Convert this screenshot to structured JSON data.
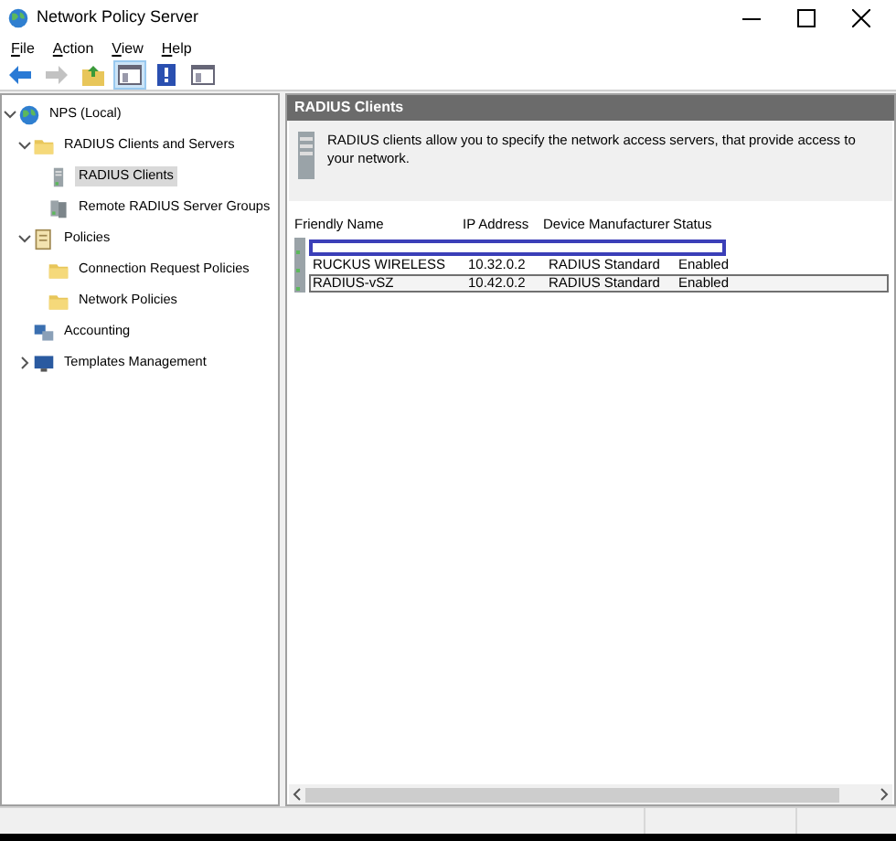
{
  "window": {
    "title": "Network Policy Server"
  },
  "menu": [
    "File",
    "Action",
    "View",
    "Help"
  ],
  "toolbar": [
    {
      "kind": "back",
      "disabled": false,
      "selected": false
    },
    {
      "kind": "forward",
      "disabled": true,
      "selected": false
    },
    {
      "kind": "up",
      "disabled": false,
      "selected": false
    },
    {
      "kind": "pane",
      "disabled": false,
      "selected": true
    },
    {
      "kind": "help",
      "disabled": false,
      "selected": false
    },
    {
      "kind": "pane",
      "disabled": false,
      "selected": false
    }
  ],
  "tree": [
    {
      "label": "NPS (Local)",
      "selected": false,
      "expanded": true,
      "children": [
        {
          "label": "RADIUS Clients and Servers",
          "selected": false,
          "expanded": true,
          "children": [
            {
              "label": "RADIUS Clients",
              "selected": true
            },
            {
              "label": "Remote RADIUS Server Groups",
              "selected": false
            }
          ]
        },
        {
          "label": "Policies",
          "selected": false,
          "expanded": true,
          "children": [
            {
              "label": "Connection Request Policies",
              "selected": false
            },
            {
              "label": "Network Policies",
              "selected": false
            }
          ]
        },
        {
          "label": "Accounting",
          "selected": false
        },
        {
          "label": "Templates Management",
          "selected": false,
          "expanded": false
        }
      ]
    }
  ],
  "panel": {
    "title": "RADIUS Clients",
    "description": "RADIUS clients allow you to specify the network access servers, that provide access to your network."
  },
  "table": {
    "columns": [
      "Friendly Name",
      "IP Address",
      "Device Manufacturer",
      "Status"
    ],
    "rows": [
      {
        "kind": "redacted"
      },
      {
        "kind": "client",
        "focused": false,
        "cells": [
          "RUCKUS WIRELESS",
          "10.32.0.2",
          "RADIUS Standard",
          "Enabled"
        ]
      },
      {
        "kind": "client",
        "focused": true,
        "cells": [
          "RADIUS-vSZ",
          "10.42.0.2",
          "RADIUS Standard",
          "Enabled"
        ]
      }
    ]
  }
}
